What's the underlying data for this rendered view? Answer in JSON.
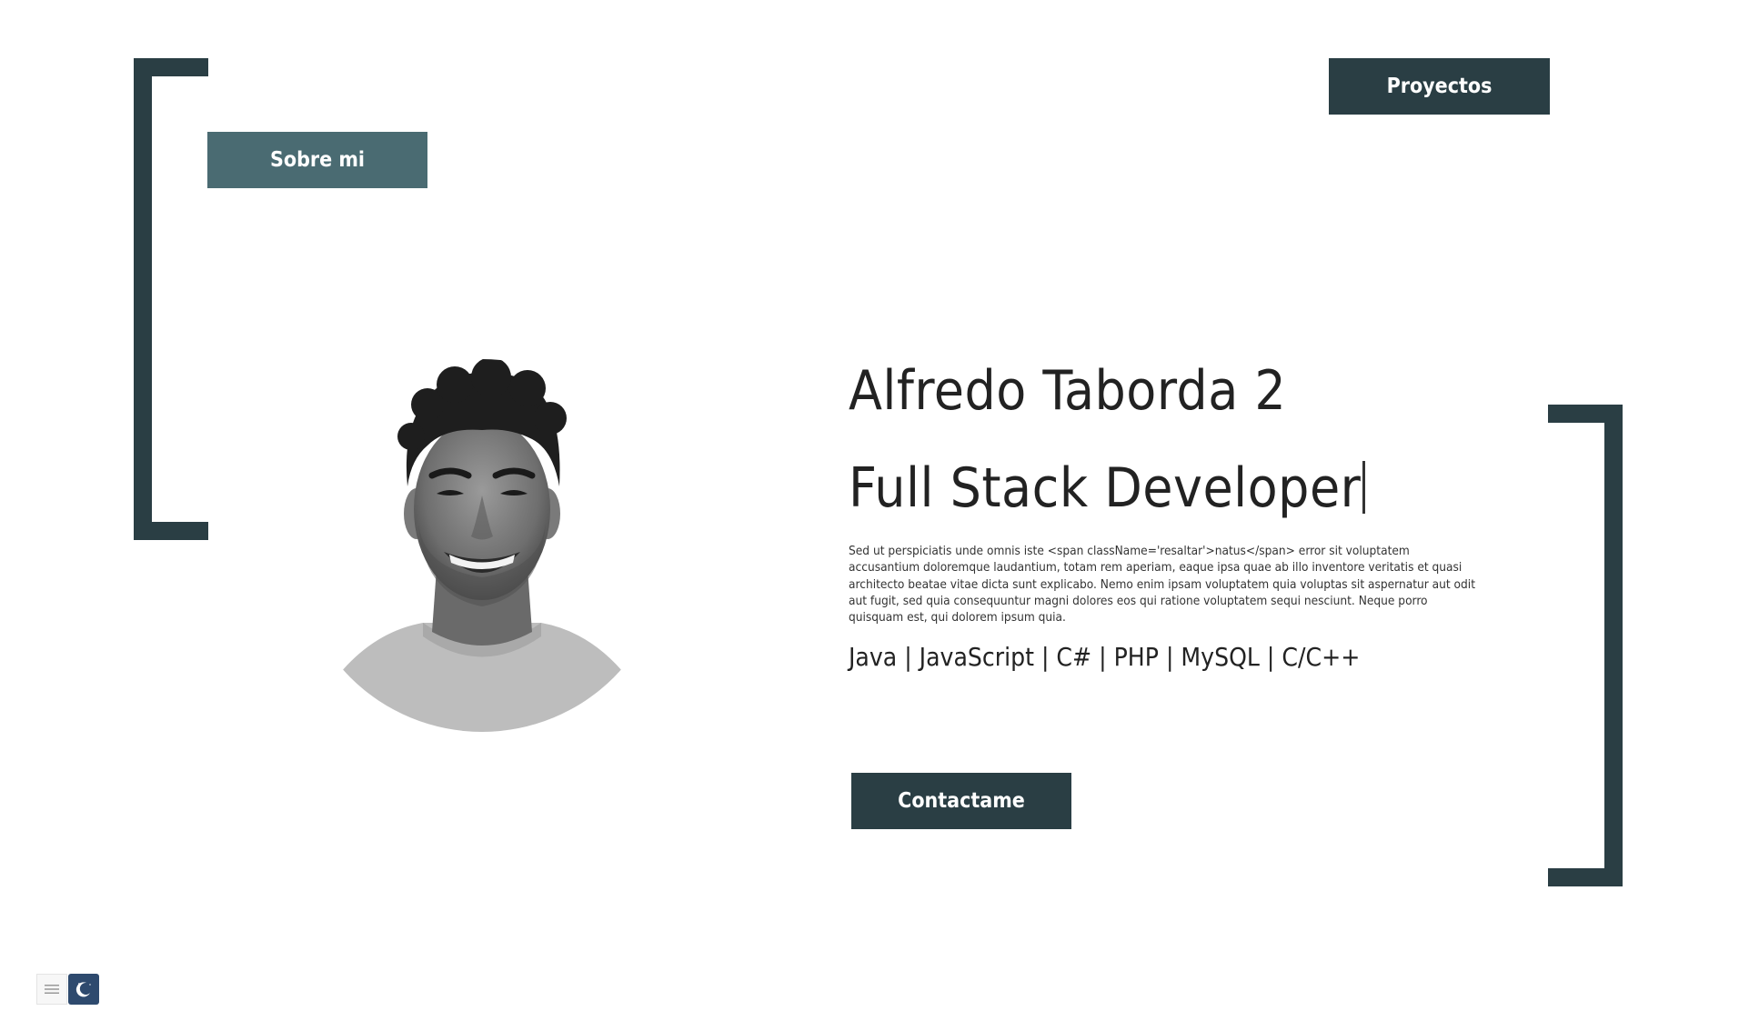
{
  "nav": {
    "about_label": "Sobre mi",
    "projects_label": "Proyectos"
  },
  "hero": {
    "name": "Alfredo Taborda 2",
    "role": "Full Stack Developer",
    "description": "Sed ut perspiciatis unde omnis iste <span className='resaltar'>natus</span> error sit voluptatem accusantium doloremque laudantium, totam rem aperiam, eaque ipsa quae ab illo inventore veritatis et quasi architecto beatae vitae dicta sunt explicabo. Nemo enim ipsam voluptatem quia voluptas sit aspernatur aut odit aut fugit, sed quia consequuntur magni dolores eos qui ratione voluptatem sequi nesciunt. Neque porro quisquam est, qui dolorem ipsum quia.",
    "skills": "Java | JavaScript | C# | PHP | MySQL | C/C++",
    "contact_label": "Contactame"
  },
  "controls": {
    "menu_icon": "hamburger-icon",
    "theme_icon": "moon-icon"
  },
  "colors": {
    "primary": "#2a3e44",
    "secondary": "#4a6b72",
    "theme_toggle": "#2e4a6e"
  }
}
